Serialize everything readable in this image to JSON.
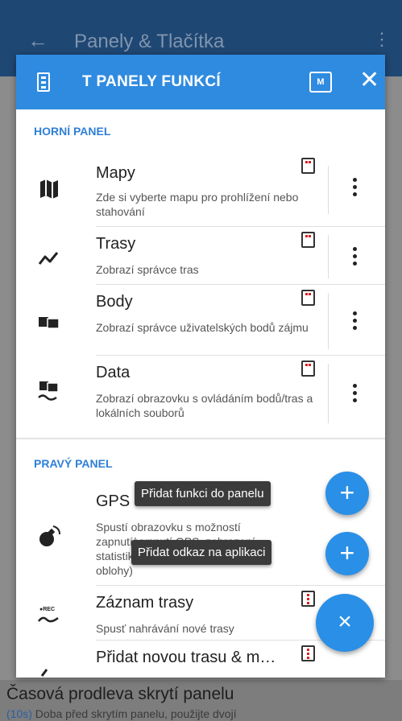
{
  "background": {
    "appbar_title": "Panely & Tlačítka",
    "back_icon": "arrow-left-icon",
    "bottom_title": "Časová prodleva skrytí panelu",
    "bottom_accent": "(10s)",
    "bottom_text": " Doba před skrytím panelu, použijte dvojí"
  },
  "dialog": {
    "title": "T PANELY FUNKCÍ",
    "badge": "M",
    "close_glyph": "✕",
    "sections": {
      "top": "HORNÍ PANEL",
      "right": "PRAVÝ PANEL"
    },
    "items": [
      {
        "title": "Mapy",
        "desc": "Zde si vyberte mapu pro prohlížení nebo stahování",
        "icon": "map-icon"
      },
      {
        "title": "Trasy",
        "desc": "Zobrazí správce tras",
        "icon": "route-icon"
      },
      {
        "title": "Body",
        "desc": "Zobrazí správce uživatelských bodů zájmu",
        "icon": "points-icon"
      },
      {
        "title": "Data",
        "desc": "Zobrazí obrazovku s ovládáním bodů/tras a lokálních souborů",
        "icon": "data-icon"
      },
      {
        "title": "GPS",
        "desc_a": "Spustí obrazovku s možností",
        "desc_b": "zapnutí/vypnutí GPS, zobrazení",
        "desc_c": "statistik",
        "desc_d": "oblohy)",
        "icon": "satellite-icon"
      },
      {
        "title": "Záznam trasy",
        "desc": "Spusť nahrávání nové trasy",
        "icon": "track-record-icon",
        "rec_label": "●REC"
      },
      {
        "title": "Přidat novou trasu & m…",
        "icon": "add-route-icon"
      }
    ]
  },
  "fabs": {
    "add_function_tooltip": "Přidat funkci do panelu",
    "add_app_tooltip": "Přidat odkaz na aplikaci",
    "plus": "+",
    "close": "×"
  },
  "colors": {
    "accent": "#2f8be0",
    "appbar": "#1f4773",
    "section": "#2f7fd6"
  }
}
